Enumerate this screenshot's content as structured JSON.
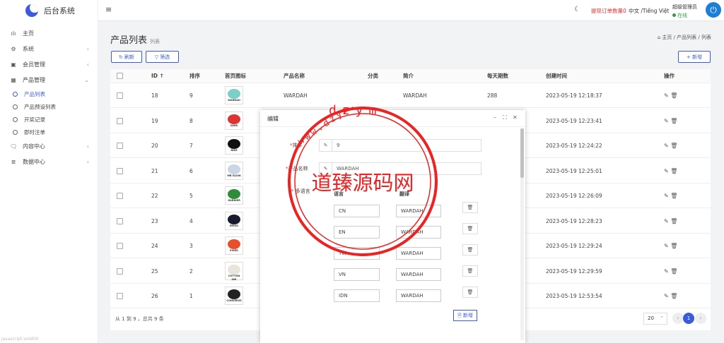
{
  "app": {
    "title": "后台系统"
  },
  "sidebar": {
    "items": [
      {
        "label": "主页",
        "icon": "bar-chart-icon"
      },
      {
        "label": "系统",
        "icon": "gear-icon",
        "arrow": "‹"
      },
      {
        "label": "会员管理",
        "icon": "id-card-icon",
        "arrow": "‹"
      },
      {
        "label": "产品管理",
        "icon": "grid-icon",
        "arrow": "⌄"
      }
    ],
    "subitems": [
      "产品列表",
      "产品预设列表",
      "开奖记录",
      "即时注单"
    ],
    "items2": [
      {
        "label": "内容中心",
        "icon": "chat-icon",
        "arrow": "‹"
      },
      {
        "label": "数据中心",
        "icon": "database-icon",
        "arrow": "‹"
      }
    ],
    "bottom_text": "javascript:void(0)"
  },
  "topbar": {
    "alert": "提现订单数量0",
    "lang": "中文 /Tiếng Việt",
    "admin_name": "超级管理员",
    "status": "在线"
  },
  "page": {
    "title": "产品列表",
    "subtitle": "列表",
    "breadcrumb": "主页 / 产品列表 / 列表",
    "refresh": "↻ 刷新",
    "filter": "▽ 筛选",
    "add": "+ 新增"
  },
  "table": {
    "headers": [
      "ID ↑",
      "排序",
      "首页图标",
      "产品名称",
      "分类",
      "简介",
      "每天期数",
      "创建时间",
      "操作"
    ],
    "rows": [
      {
        "id": "18",
        "sort": "9",
        "logo": "WARDAH",
        "color": "#7ad0c8",
        "name": "WARDAH",
        "intro": "WARDAH",
        "daily": "288",
        "created": "2023-05-19 12:18:37"
      },
      {
        "id": "19",
        "sort": "8",
        "logo": "VANS",
        "color": "#d33",
        "name": "",
        "intro": "",
        "daily": "",
        "created": "2023-05-19 12:23:41"
      },
      {
        "id": "20",
        "sort": "7",
        "logo": "NIKE",
        "color": "#111",
        "name": "",
        "intro": "",
        "daily": "",
        "created": "2023-05-19 12:24:22"
      },
      {
        "id": "21",
        "sort": "6",
        "logo": "MB GLOW",
        "color": "#c9d6e6",
        "name": "",
        "intro": "",
        "daily": "",
        "created": "2023-05-19 12:25:01"
      },
      {
        "id": "22",
        "sort": "5",
        "logo": "GARNIER",
        "color": "#2f8d3a",
        "name": "",
        "intro": "",
        "daily": "",
        "created": "2023-05-19 12:26:09"
      },
      {
        "id": "23",
        "sort": "4",
        "logo": "ERIGO",
        "color": "#1a1a2e",
        "name": "",
        "intro": "",
        "daily": "",
        "created": "2023-05-19 12:28:23"
      },
      {
        "id": "24",
        "sort": "3",
        "logo": "EIGER",
        "color": "#e8502a",
        "name": "",
        "intro": "",
        "daily": "",
        "created": "2023-05-19 12:29:24"
      },
      {
        "id": "25",
        "sort": "2",
        "logo": "COTTON INK",
        "color": "#e9e4dc",
        "name": "",
        "intro": "",
        "daily": "",
        "created": "2023-05-19 12:29:59"
      },
      {
        "id": "26",
        "sort": "1",
        "logo": "CONVERSE",
        "color": "#222",
        "name": "",
        "intro": "",
        "daily": "",
        "created": "2023-05-19 12:53:54"
      }
    ],
    "footer": "从 1 到 9 ，总共 9 条",
    "page_size": "20",
    "current_page": "1"
  },
  "modal": {
    "title": "编辑",
    "min": "–",
    "max": "⛶",
    "close": "✕",
    "sort_label": "排序",
    "sort_value": "9",
    "name_label": "产品名称",
    "name_value": "WARDAH",
    "multi_label": "多语言",
    "col_lang": "语言",
    "col_trans": "翻译",
    "langs": [
      {
        "lang": "CN",
        "trans": "WARDAH"
      },
      {
        "lang": "EN",
        "trans": "WARDAH"
      },
      {
        "lang": "TW",
        "trans": "WARDAH"
      },
      {
        "lang": "VN",
        "trans": "WARDAH"
      },
      {
        "lang": "IDN",
        "trans": "WARDAH"
      }
    ],
    "add": "🗎 新增"
  },
  "watermark": {
    "text": "道臻源码网",
    "url_top": "dzym",
    "url_side": "www.dzym.com"
  }
}
